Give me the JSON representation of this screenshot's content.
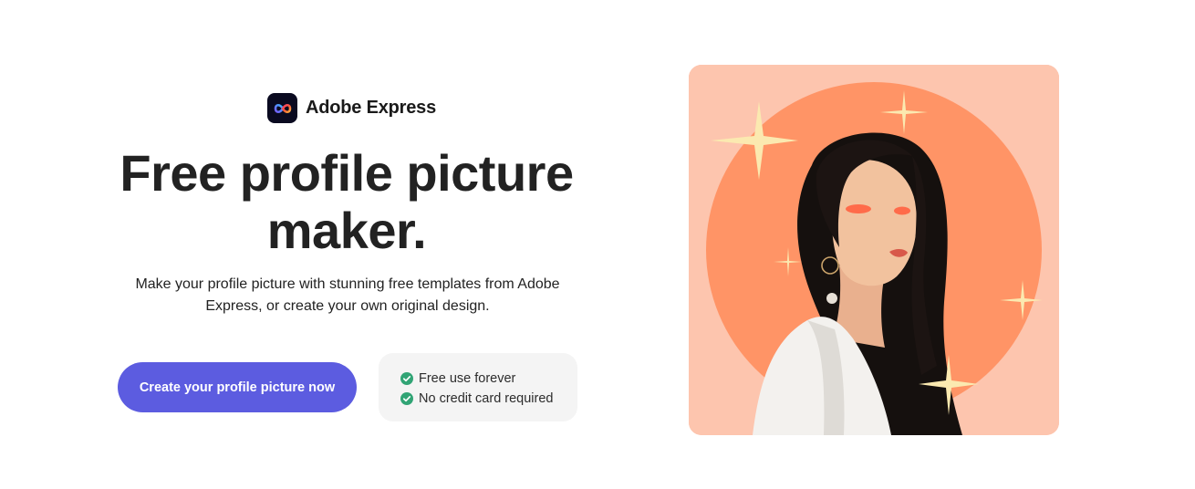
{
  "brand": {
    "name": "Adobe Express",
    "logo_icon": "adobe-express-logo-icon"
  },
  "hero": {
    "title": "Free profile picture maker.",
    "description": "Make your profile picture with stunning free templates from Adobe Express, or create your own original design.",
    "image_icon": "profile-picture-example-image"
  },
  "cta": {
    "label": "Create your profile picture now"
  },
  "features": {
    "items": [
      "Free use forever",
      "No credit card required"
    ],
    "check_icon": "check-circle-icon"
  },
  "colors": {
    "accent": "#5c5ce0",
    "check": "#31a475",
    "hero_background": "#fdc5ae",
    "hero_circle": "#ff9466",
    "sparkle": "#fbe9b0"
  }
}
